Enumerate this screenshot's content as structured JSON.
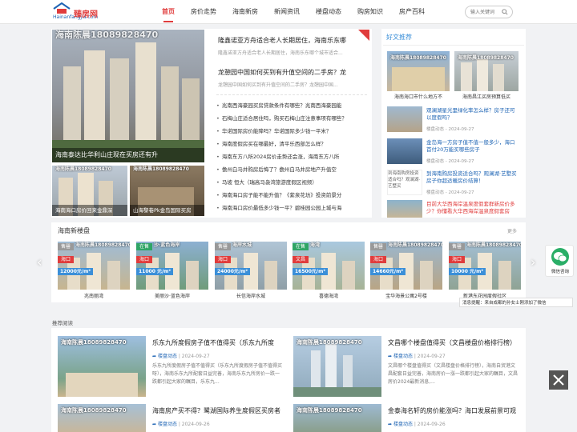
{
  "header": {
    "logo_domain": "Hainanfangjia.com",
    "logo_cn": "臻房网",
    "nav": [
      "首页",
      "房价走势",
      "海南新房",
      "新闻资讯",
      "楼盘动态",
      "购房知识",
      "房产百科"
    ],
    "search_placeholder": "输入关键词"
  },
  "hero": {
    "watermark": "海南陈晨18089828470",
    "big_caption": "海南泰达比华利山庄现在买房还有升",
    "thumbs": [
      {
        "watermark": "海南陈晨18089828470",
        "caption": "海南海口房价回来金鼎深"
      },
      {
        "watermark": "海南陈晨18089828470",
        "caption": "山海黎巷Pk金岛国际买房"
      }
    ]
  },
  "headlines": [
    {
      "title": "隆鑫诺亚方舟适合老人长期居住，海南乐东哪",
      "summary": "隆鑫诺亚方舟适合老人长期居住，海南乐东哪个城市适合..."
    },
    {
      "title": "龙憩园中国如何买到有升值空间的二手房？龙",
      "summary": "龙憩园中国如何买到有升值空间的二手房？龙憩园中国..."
    }
  ],
  "news_list": [
    "兆南西海豪园买房贷款条件有哪些？兆南西海豪园能",
    "石梅山庄适合居住吗，购买石梅山庄注意事项有哪些？",
    "华诺国际房价能降吗？华诺国际多少钱一平米？",
    "海南度假房买在哪最好，清平乐西部怎么样？",
    "海南东方八所2024房价走势还会涨，海南东方八所",
    "儋州白马井购房后悔了？儋州白马井房地产升值空",
    "马坡 恒大（瑞高马袅湾旅游度假区视频）",
    "海南海口房子能不能升值？《紫泉花坊》投资前景分",
    "海南海口房价最低多少钱一平？碧桂园公园上城与海"
  ],
  "recommend": {
    "title": "好文推荐",
    "top": [
      {
        "watermark": "海南陈晨18089828470",
        "caption": "海南海口市什么地方不"
      },
      {
        "watermark": "海南陈晨18089828470",
        "caption": "海南昌江买房预算低买"
      }
    ],
    "items": [
      {
        "title": "观澜湖星光里绿化率怎么样？房子还可以度假吗？",
        "date": "楼盘动态 - 2024-09-27"
      },
      {
        "title": "金岛海一方房子值不值一般多少，海口首付20万能买哪些房子",
        "date": "楼盘动态 - 2024-09-27"
      },
      {
        "title": "到海南购房投资适合吗？观澜湖·艺墅买房子你超适暖房价结算！",
        "date": "楼盘动态 - 2024-09-27",
        "alt": "到海南购房投资适合吗？观澜湖·艺墅买"
      },
      {
        "title": "目前大华西海岸温泉度假套群新房价多少？你懂看大华西海岸温泉度假套房",
        "date": ""
      }
    ]
  },
  "new_projects": {
    "title": "海南新楼盘",
    "more": "更多",
    "items": [
      {
        "status": "售罄",
        "status_color": "#999999",
        "city": "海口",
        "price": "12000元/m²",
        "name": "兆南丽湾",
        "wm": "海南陈晨18089828470"
      },
      {
        "status": "在售",
        "status_color": "#2fa566",
        "city": "海口",
        "price": "11000 元/m²",
        "name": "美丽沙·蓝色海岸",
        "wm": "沙·蓝色海岸"
      },
      {
        "status": "售罄",
        "status_color": "#999999",
        "city": "海口",
        "price": "24000元/m²",
        "name": "长信海岸水城",
        "wm": "海岸水城"
      },
      {
        "status": "在售",
        "status_color": "#2fa566",
        "city": "文昌",
        "price": "16500元/m²",
        "name": "喜德海湾",
        "wm": "海湾"
      },
      {
        "status": "售罄",
        "status_color": "#999999",
        "city": "海口",
        "price": "14660元/m²",
        "name": "宝华海景公寓2号楼",
        "wm": "海南陈晨18089828470"
      },
      {
        "status": "售罄",
        "status_color": "#999999",
        "city": "海口",
        "price": "10000 元/m²",
        "name": "新港东花园度假社区",
        "wm": "海南陈晨18089828470"
      }
    ]
  },
  "reading": {
    "title": "推荐阅读",
    "articles": [
      {
        "watermark": "海南陈晨18089828470",
        "title": "乐东九所度假房子值不值得买（乐东九所度",
        "cat": "楼盘动态",
        "date": "2024-09-27",
        "desc": "乐东九所度假房子值不值得买（乐东九所度假房子值不值得买呀），海南乐东九所配套日益完善，海南乐东九所房价一跌一跌都引起大家的瞩目，乐东九..."
      },
      {
        "watermark": "海南陈晨18089828470",
        "title": "文昌哪个楼盘值得买（文昌楼盘价格排行榜）",
        "cat": "楼盘动态",
        "date": "2024-09-27",
        "desc": "文昌哪个楼盘值得买（文昌楼盘价格排行榜），海南自贸港文昌配套日益完善，海南房价一涨一跌都引起大家的瞩目，文昌房价2024最新消息,..."
      },
      {
        "watermark": "海南陈晨18089828470",
        "title": "海南房产买不得？鹭湖国际养生度假区买房者",
        "cat": "楼盘动态",
        "date": "2024-09-26",
        "desc": ""
      },
      {
        "watermark": "海南陈晨18089828470",
        "title": "金泰海名轩的房价能涨吗？海口发展前景可观",
        "cat": "楼盘动态",
        "date": "2024-09-26",
        "desc": ""
      }
    ]
  },
  "float": {
    "wechat_label": "微信咨询",
    "notice": "消息提醒：来自成都的孙女士刚添加了微信"
  }
}
